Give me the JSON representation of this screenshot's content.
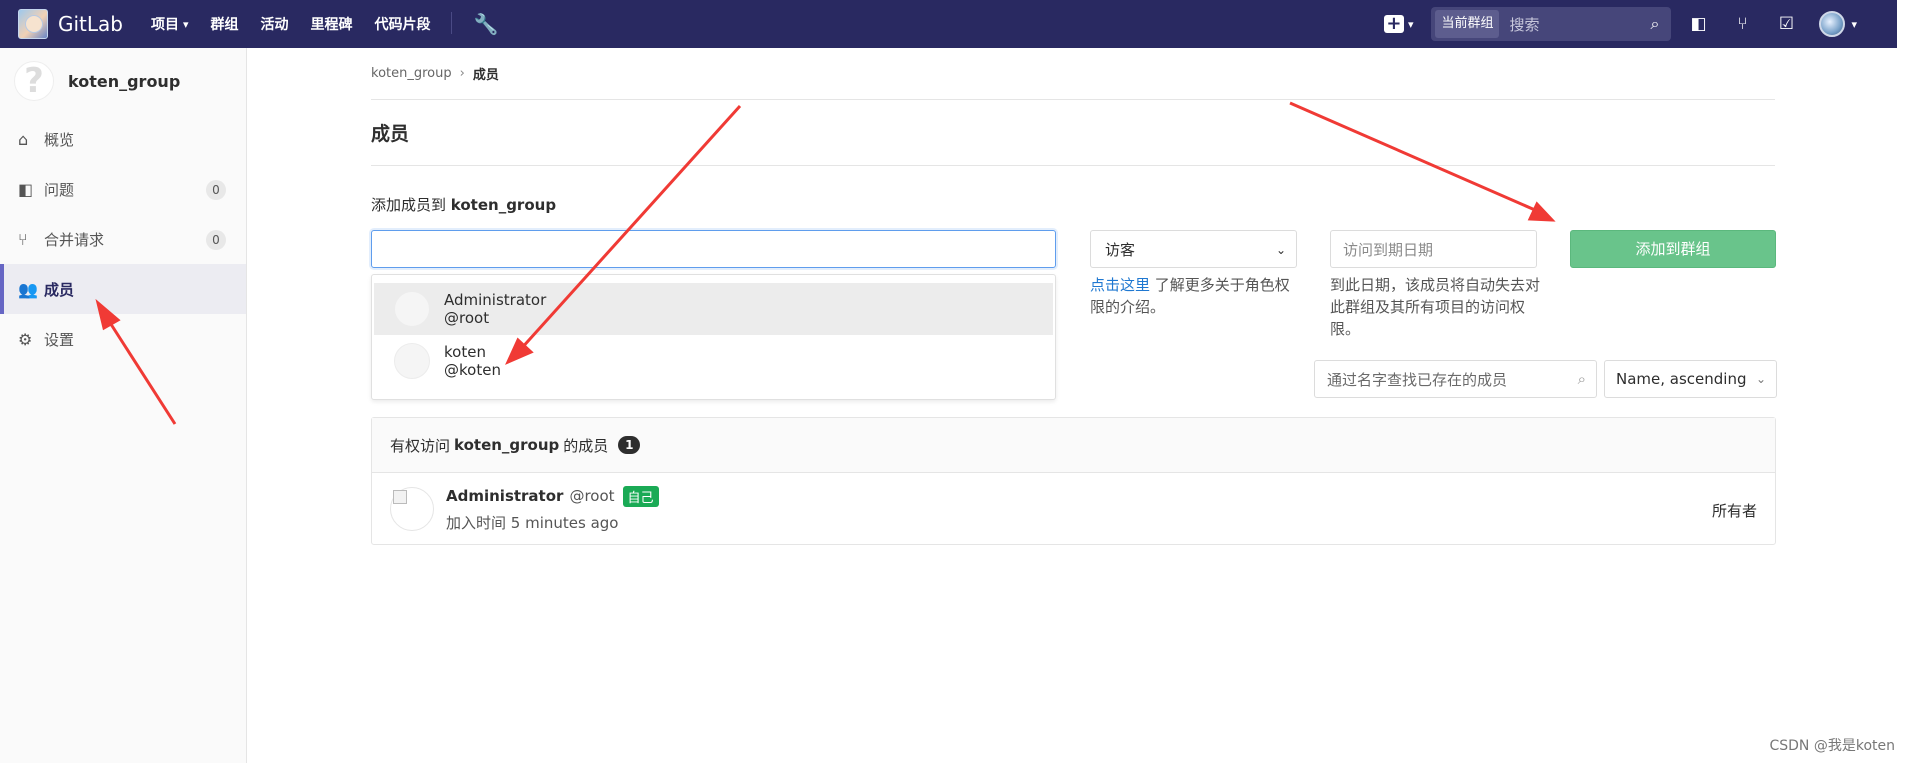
{
  "topbar": {
    "brand": "GitLab",
    "nav": [
      "项目",
      "群组",
      "活动",
      "里程碑",
      "代码片段"
    ],
    "search_scope": "当前群组",
    "search_placeholder": "搜索"
  },
  "sidebar": {
    "group_name": "koten_group",
    "items": [
      {
        "label": "概览",
        "count": ""
      },
      {
        "label": "问题",
        "count": "0"
      },
      {
        "label": "合并请求",
        "count": "0"
      },
      {
        "label": "成员",
        "count": ""
      },
      {
        "label": "设置",
        "count": ""
      }
    ]
  },
  "breadcrumb": {
    "parent": "koten_group",
    "current": "成员"
  },
  "page_title": "成员",
  "add_member": {
    "label_prefix": "添加成员到",
    "label_group": "koten_group",
    "dropdown": [
      {
        "name": "Administrator",
        "username": "@root"
      },
      {
        "name": "koten",
        "username": "@koten"
      }
    ],
    "role_value": "访客",
    "role_help_link": "点击这里",
    "role_help_text": " 了解更多关于角色权限的介绍。",
    "date_placeholder": "访问到期日期",
    "date_help": "到此日期，该成员将自动失去对此群组及其所有项目的访问权限。",
    "add_button": "添加到群组"
  },
  "filter": {
    "search_placeholder": "通过名字查找已存在的成员",
    "sort_value": "Name, ascending"
  },
  "members_panel": {
    "head_prefix": "有权访问",
    "head_group": "koten_group",
    "head_suffix": "的成员",
    "count": "1",
    "members": [
      {
        "name": "Administrator",
        "username": "@root",
        "badge": "自己",
        "joined": "加入时间 5 minutes ago",
        "role": "所有者"
      }
    ]
  },
  "watermark": "CSDN @我是koten",
  "colors": {
    "topbar": "#292961",
    "add_button": "#69c48b",
    "annotation_arrow": "#f03a35",
    "self_badge": "#1aaa55"
  }
}
